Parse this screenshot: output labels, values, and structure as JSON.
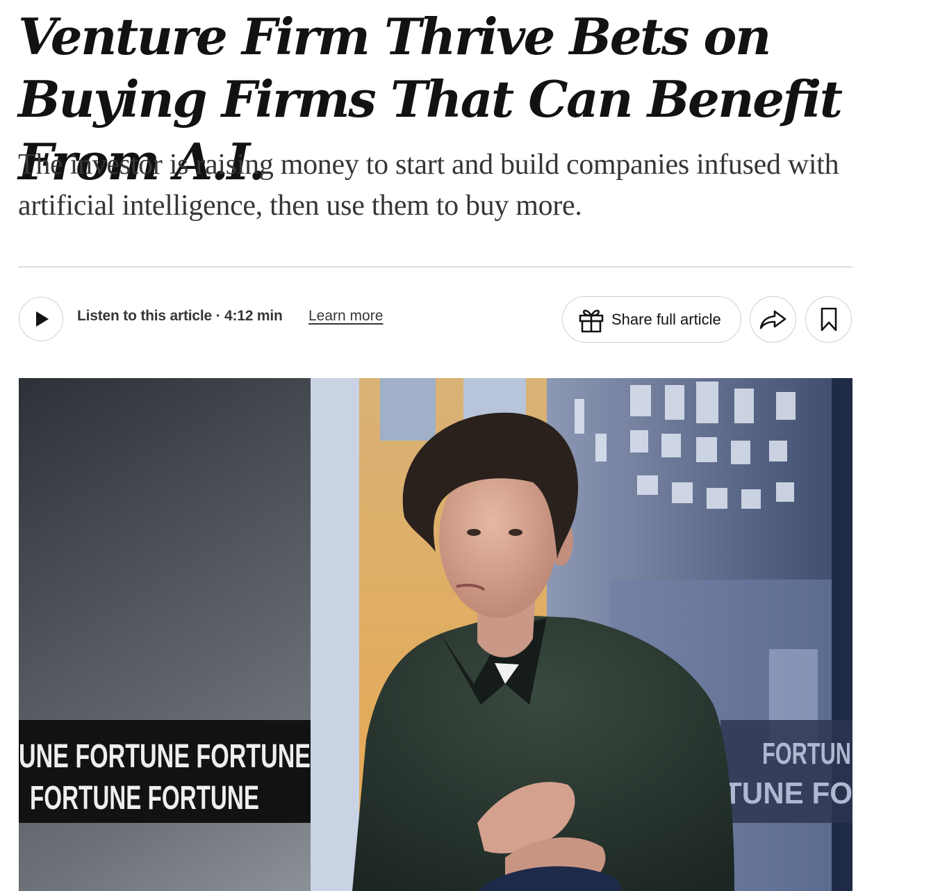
{
  "article": {
    "headline": "Venture Firm Thrive Bets on Buying Firms That Can Benefit From A.I.",
    "summary": "The investor is raising money to start and build companies infused with artificial intelligence, then use them to buy more."
  },
  "toolbar": {
    "listen_label": "Listen to this article · 4:12 min",
    "learn_more_label": "Learn more",
    "share_full_label": "Share full article",
    "icons": {
      "play": "play-icon",
      "gift": "gift-icon",
      "share": "share-arrow-icon",
      "save": "bookmark-icon"
    }
  },
  "photo": {
    "banner_lines": [
      "UNE FORTUNE FORTUNE",
      "FORTUNE FORTUNE"
    ],
    "banner_right_lines": [
      "FORTUN",
      "TUNE FO"
    ]
  },
  "colors": {
    "text": "#121212",
    "summary_text": "#363636",
    "border": "#cfcfcf",
    "divider": "#dfdfdf"
  }
}
